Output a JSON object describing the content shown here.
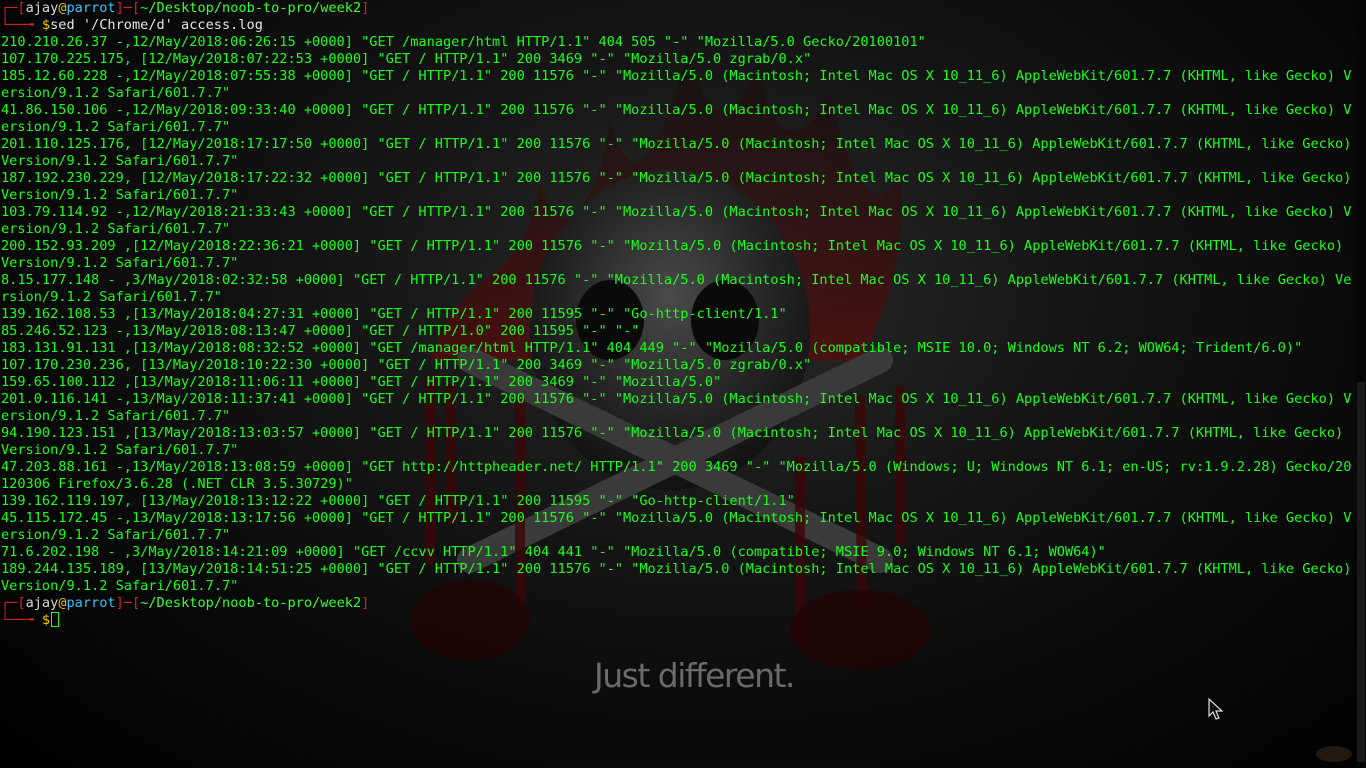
{
  "prompt": {
    "user": "ajay",
    "at": "@",
    "host": "parrot",
    "path": "~/Desktop/noob-to-pro/week2",
    "symbol": "$"
  },
  "command": "sed '/Chrome/d' access.log",
  "output_lines": [
    "210.210.26.37 -,12/May/2018:06:26:15 +0000] \"GET /manager/html HTTP/1.1\" 404 505 \"-\" \"Mozilla/5.0 Gecko/20100101\"",
    "107.170.225.175, [12/May/2018:07:22:53 +0000] \"GET / HTTP/1.1\" 200 3469 \"-\" \"Mozilla/5.0 zgrab/0.x\"",
    "185.12.60.228 -,12/May/2018:07:55:38 +0000] \"GET / HTTP/1.1\" 200 11576 \"-\" \"Mozilla/5.0 (Macintosh; Intel Mac OS X 10_11_6) AppleWebKit/601.7.7 (KHTML, like Gecko) Version/9.1.2 Safari/601.7.7\"",
    "41.86.150.106 -,12/May/2018:09:33:40 +0000] \"GET / HTTP/1.1\" 200 11576 \"-\" \"Mozilla/5.0 (Macintosh; Intel Mac OS X 10_11_6) AppleWebKit/601.7.7 (KHTML, like Gecko) Version/9.1.2 Safari/601.7.7\"",
    "201.110.125.176, [12/May/2018:17:17:50 +0000] \"GET / HTTP/1.1\" 200 11576 \"-\" \"Mozilla/5.0 (Macintosh; Intel Mac OS X 10_11_6) AppleWebKit/601.7.7 (KHTML, like Gecko) Version/9.1.2 Safari/601.7.7\"",
    "187.192.230.229, [12/May/2018:17:22:32 +0000] \"GET / HTTP/1.1\" 200 11576 \"-\" \"Mozilla/5.0 (Macintosh; Intel Mac OS X 10_11_6) AppleWebKit/601.7.7 (KHTML, like Gecko) Version/9.1.2 Safari/601.7.7\"",
    "103.79.114.92 -,12/May/2018:21:33:43 +0000] \"GET / HTTP/1.1\" 200 11576 \"-\" \"Mozilla/5.0 (Macintosh; Intel Mac OS X 10_11_6) AppleWebKit/601.7.7 (KHTML, like Gecko) Version/9.1.2 Safari/601.7.7\"",
    "200.152.93.209 ,[12/May/2018:22:36:21 +0000] \"GET / HTTP/1.1\" 200 11576 \"-\" \"Mozilla/5.0 (Macintosh; Intel Mac OS X 10_11_6) AppleWebKit/601.7.7 (KHTML, like Gecko) Version/9.1.2 Safari/601.7.7\"",
    "8.15.177.148 - ,3/May/2018:02:32:58 +0000] \"GET / HTTP/1.1\" 200 11576 \"-\" \"Mozilla/5.0 (Macintosh; Intel Mac OS X 10_11_6) AppleWebKit/601.7.7 (KHTML, like Gecko) Version/9.1.2 Safari/601.7.7\"",
    "139.162.108.53 ,[13/May/2018:04:27:31 +0000] \"GET / HTTP/1.1\" 200 11595 \"-\" \"Go-http-client/1.1\"",
    "85.246.52.123 -,13/May/2018:08:13:47 +0000] \"GET / HTTP/1.0\" 200 11595 \"-\" \"-\"",
    "183.131.91.131 ,[13/May/2018:08:32:52 +0000] \"GET /manager/html HTTP/1.1\" 404 449 \"-\" \"Mozilla/5.0 (compatible; MSIE 10.0; Windows NT 6.2; WOW64; Trident/6.0)\"",
    "107.170.230.236, [13/May/2018:10:22:30 +0000] \"GET / HTTP/1.1\" 200 3469 \"-\" \"Mozilla/5.0 zgrab/0.x\"",
    "159.65.100.112 ,[13/May/2018:11:06:11 +0000] \"GET / HTTP/1.1\" 200 3469 \"-\" \"Mozilla/5.0\"",
    "201.0.116.141 -,13/May/2018:11:37:41 +0000] \"GET / HTTP/1.1\" 200 11576 \"-\" \"Mozilla/5.0 (Macintosh; Intel Mac OS X 10_11_6) AppleWebKit/601.7.7 (KHTML, like Gecko) Version/9.1.2 Safari/601.7.7\"",
    "94.190.123.151 ,[13/May/2018:13:03:57 +0000] \"GET / HTTP/1.1\" 200 11576 \"-\" \"Mozilla/5.0 (Macintosh; Intel Mac OS X 10_11_6) AppleWebKit/601.7.7 (KHTML, like Gecko) Version/9.1.2 Safari/601.7.7\"",
    "47.203.88.161 -,13/May/2018:13:08:59 +0000] \"GET http://httpheader.net/ HTTP/1.1\" 200 3469 \"-\" \"Mozilla/5.0 (Windows; U; Windows NT 6.1; en-US; rv:1.9.2.28) Gecko/20120306 Firefox/3.6.28 (.NET CLR 3.5.30729)\"",
    "139.162.119.197, [13/May/2018:13:12:22 +0000] \"GET / HTTP/1.1\" 200 11595 \"-\" \"Go-http-client/1.1\"",
    "45.115.172.45 -,13/May/2018:13:17:56 +0000] \"GET / HTTP/1.1\" 200 11576 \"-\" \"Mozilla/5.0 (Macintosh; Intel Mac OS X 10_11_6) AppleWebKit/601.7.7 (KHTML, like Gecko) Version/9.1.2 Safari/601.7.7\"",
    "71.6.202.198 - ,3/May/2018:14:21:09 +0000] \"GET /ccvv HTTP/1.1\" 404 441 \"-\" \"Mozilla/5.0 (compatible; MSIE 9.0; Windows NT 6.1; WOW64)\"",
    "189.244.135.189, [13/May/2018:14:51:25 +0000] \"GET / HTTP/1.1\" 200 11576 \"-\" \"Mozilla/5.0 (Macintosh; Intel Mac OS X 10_11_6) AppleWebKit/601.7.7 (KHTML, like Gecko) Version/9.1.2 Safari/601.7.7\""
  ],
  "wallpaper": {
    "tagline": "Just different."
  },
  "colors": {
    "output_text": "#19ff19",
    "prompt_bracket": "#d42222",
    "hostname": "#33c4ff",
    "background": "#000000"
  }
}
